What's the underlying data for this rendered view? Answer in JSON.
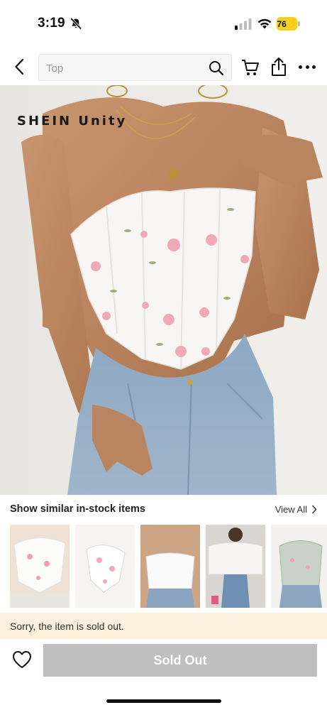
{
  "status_bar": {
    "time": "3:19",
    "battery": "76"
  },
  "nav": {
    "search_placeholder": "Top"
  },
  "product": {
    "brand_logo": "SHEIN Unity"
  },
  "similar": {
    "title": "Show similar in-stock items",
    "view_all": "View All"
  },
  "banner": {
    "message": "Sorry, the item is sold out."
  },
  "bottom": {
    "sold_out_label": "Sold Out"
  },
  "colors": {
    "banner_bg": "#fbf1dc",
    "disabled_button": "#bfbfbf",
    "battery": "#f4d21c"
  },
  "icons": [
    "bell-off-icon",
    "signal-icon",
    "wifi-icon",
    "battery-icon",
    "back-arrow-icon",
    "search-icon",
    "cart-icon",
    "share-icon",
    "more-icon",
    "chevron-right-icon",
    "heart-icon"
  ]
}
